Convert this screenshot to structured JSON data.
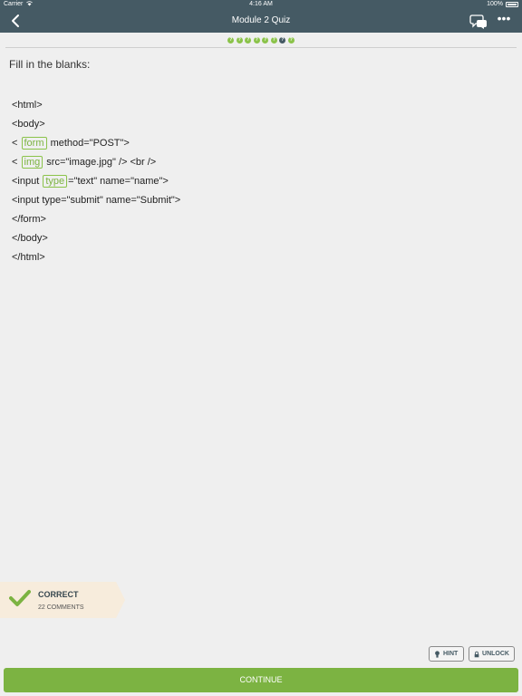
{
  "status_bar": {
    "carrier": "Carrier",
    "time": "4:16 AM",
    "battery": "100%"
  },
  "nav": {
    "title": "Module 2 Quiz"
  },
  "progress": {
    "dots": [
      "?",
      "?",
      "?",
      "?",
      "?",
      "?",
      "?",
      "?"
    ],
    "current_index": 6
  },
  "question": {
    "instruction": "Fill in the blanks:",
    "lines": {
      "l1": "<html>",
      "l2": "<body>",
      "l3_before": "<",
      "l3_blank": "form",
      "l3_after": "method=\"POST\">",
      "l4_before": "<",
      "l4_blank": "img",
      "l4_after": "src=\"image.jpg\" /> <br />",
      "l5_before": "<input",
      "l5_blank": "type",
      "l5_after": "=\"text\" name=\"name\">",
      "l6": "<input type=\"submit\" name=\"Submit\">",
      "l7": "</form>",
      "l8": "</body>",
      "l9": "</html>"
    }
  },
  "result": {
    "title": "CORRECT",
    "comments": "22 COMMENTS",
    "accent": "#7cb342"
  },
  "buttons": {
    "hint": "HINT",
    "unlock": "UNLOCK",
    "continue": "CONTINUE"
  },
  "colors": {
    "header": "#455a64",
    "accent": "#8bc34a",
    "background": "#efefef"
  }
}
